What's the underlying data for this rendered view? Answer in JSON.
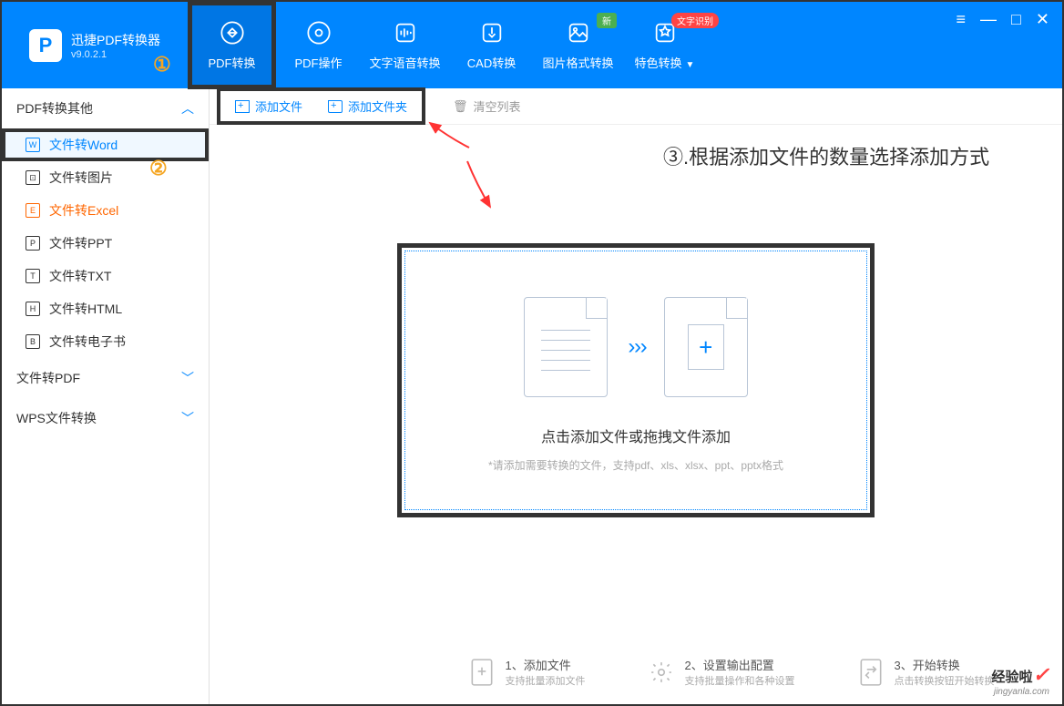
{
  "app": {
    "name": "迅捷PDF转换器",
    "version": "v9.0.2.1"
  },
  "nav": {
    "tabs": [
      {
        "label": "PDF转换"
      },
      {
        "label": "PDF操作"
      },
      {
        "label": "文字语音转换"
      },
      {
        "label": "CAD转换"
      },
      {
        "label": "图片格式转换"
      },
      {
        "label": "特色转换"
      }
    ],
    "badge_new": "新",
    "badge_ocr": "文字识别"
  },
  "window_controls": {
    "menu": "≡",
    "min": "—",
    "max": "□",
    "close": "✕"
  },
  "sidebar": {
    "section1": "PDF转换其他",
    "items": [
      {
        "label": "文件转Word",
        "glyph": "W"
      },
      {
        "label": "文件转图片",
        "glyph": "⊡"
      },
      {
        "label": "文件转Excel",
        "glyph": "E"
      },
      {
        "label": "文件转PPT",
        "glyph": "P"
      },
      {
        "label": "文件转TXT",
        "glyph": "T"
      },
      {
        "label": "文件转HTML",
        "glyph": "H"
      },
      {
        "label": "文件转电子书",
        "glyph": "B"
      }
    ],
    "section2": "文件转PDF",
    "section3": "WPS文件转换"
  },
  "toolbar": {
    "add_file": "添加文件",
    "add_folder": "添加文件夹",
    "clear_list": "清空列表"
  },
  "annotations": {
    "num1": "①",
    "num2": "②",
    "text3": "③.根据添加文件的数量选择添加方式"
  },
  "dropzone": {
    "main": "点击添加文件或拖拽文件添加",
    "sub": "*请添加需要转换的文件，支持pdf、xls、xlsx、ppt、pptx格式",
    "arrows": "› › ›",
    "plus": "+"
  },
  "steps": [
    {
      "title": "1、添加文件",
      "sub": "支持批量添加文件"
    },
    {
      "title": "2、设置输出配置",
      "sub": "支持批量操作和各种设置"
    },
    {
      "title": "3、开始转换",
      "sub": "点击转换按钮开始转换"
    }
  ],
  "watermark": {
    "text": "经验啦",
    "check": "✓",
    "url": "jingyanla.com"
  }
}
